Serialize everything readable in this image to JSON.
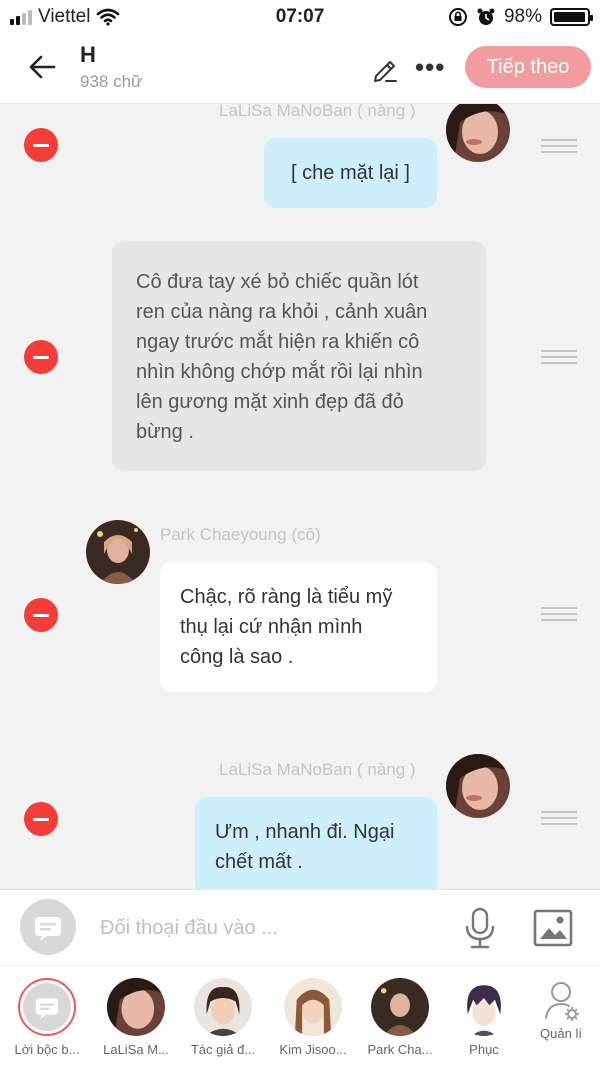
{
  "status_bar": {
    "carrier": "Viettel",
    "time": "07:07",
    "battery": "98%",
    "battery_level": 0.98
  },
  "header": {
    "title": "H",
    "subtitle": "938 chữ",
    "next_button": "Tiếp theo"
  },
  "messages": [
    {
      "speaker": "LaLiSa MaNoBan ( nàng )",
      "text": "[ che mặt lại ]",
      "style": "blue"
    },
    {
      "speaker": "",
      "text": "Cô đưa tay xé bỏ chiếc quần lót ren của nàng ra khỏi , cảnh xuân ngay trước mắt hiện ra khiến cô nhìn không chớp mắt rồi lại nhìn lên gương mặt xinh đẹp đã đỏ bừng .",
      "lines": [
        "Cô đưa tay xé bỏ chiếc quần lót",
        "ren của nàng ra khỏi , cảnh xuân",
        "ngay trước mắt hiện ra khiến cô",
        "nhìn không chớp mắt rồi lại nhìn",
        "lên gương mặt xinh đẹp đã đỏ",
        "bừng ."
      ],
      "style": "gray"
    },
    {
      "speaker": "Park Chaeyoung (cô)",
      "text": "Chậc, rõ ràng là tiểu mỹ thụ lại cứ nhận mình công là sao .",
      "lines": [
        "Chậc, rõ ràng là tiểu mỹ",
        "thụ lại cứ nhận mình",
        "công là sao ."
      ],
      "style": "white"
    },
    {
      "speaker": "LaLiSa MaNoBan ( nàng )",
      "text": "Ưm , nhanh đi. Ngại chết mất .",
      "lines": [
        "Ưm , nhanh đi. Ngại",
        "chết mất ."
      ],
      "style": "blue"
    }
  ],
  "input": {
    "placeholder": "Đối thoại đầu vào ..."
  },
  "characters": [
    {
      "label": "Lời bộc b..."
    },
    {
      "label": "LaLiSa M..."
    },
    {
      "label": "Tác giả đ..."
    },
    {
      "label": "Kim Jisoo..."
    },
    {
      "label": "Park Cha..."
    },
    {
      "label": "Phục"
    },
    {
      "label": "Quản lí"
    }
  ],
  "colors": {
    "accent": "#f39ca0",
    "delete": "#f33d36",
    "bubble_blue": "#cdeffb",
    "bubble_gray": "#e6e6e6"
  },
  "icons": [
    "signal-icon",
    "wifi-icon",
    "lock-rotation-icon",
    "alarm-icon",
    "battery-icon",
    "back-arrow-icon",
    "pencil-icon",
    "more-icon",
    "minus-icon",
    "drag-handle-icon",
    "chat-bubble-icon",
    "microphone-icon",
    "image-icon",
    "person-gear-icon"
  ]
}
